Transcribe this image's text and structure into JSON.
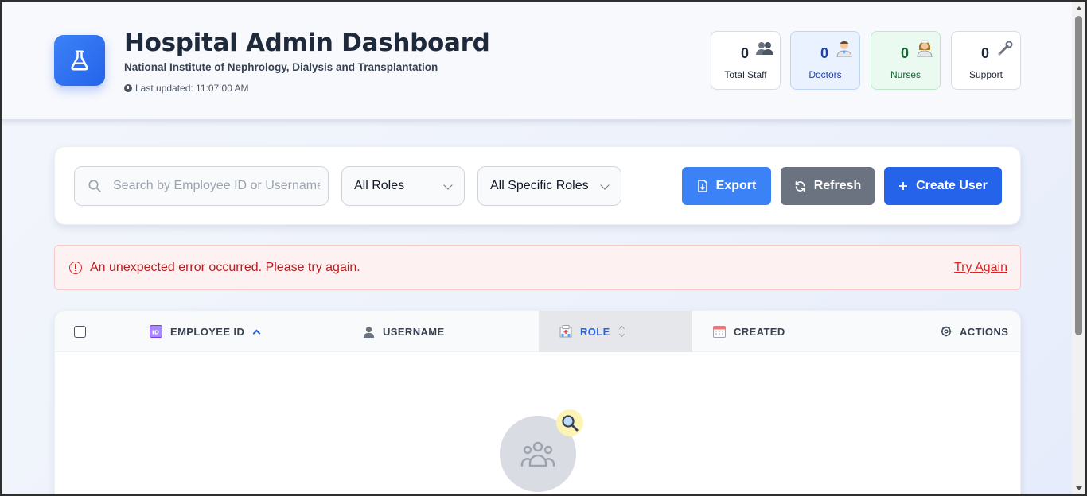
{
  "header": {
    "title": "Hospital Admin Dashboard",
    "subtitle": "National Institute of Nephrology, Dialysis and Transplantation",
    "last_updated": "Last updated: 11:07:00 AM",
    "logo_icon": "flask-icon"
  },
  "stats": [
    {
      "value": "0",
      "label": "Total Staff",
      "icon": "staff-group-icon"
    },
    {
      "value": "0",
      "label": "Doctors",
      "icon": "doctor-icon"
    },
    {
      "value": "0",
      "label": "Nurses",
      "icon": "nurse-icon"
    },
    {
      "value": "0",
      "label": "Support",
      "icon": "wrench-icon"
    }
  ],
  "toolbar": {
    "search_placeholder": "Search by Employee ID or Username",
    "roles_select": "All Roles",
    "specific_roles_select": "All Specific Roles",
    "export_label": "Export",
    "refresh_label": "Refresh",
    "create_label": "Create User"
  },
  "error": {
    "message": "An unexpected error occurred. Please try again.",
    "action": "Try Again"
  },
  "table": {
    "columns": [
      "EMPLOYEE ID",
      "USERNAME",
      "ROLE",
      "CREATED",
      "ACTIONS"
    ]
  },
  "colors": {
    "primary": "#2563eb",
    "export": "#3b82f6",
    "refresh": "#6b7280",
    "error_text": "#b91c1c"
  }
}
